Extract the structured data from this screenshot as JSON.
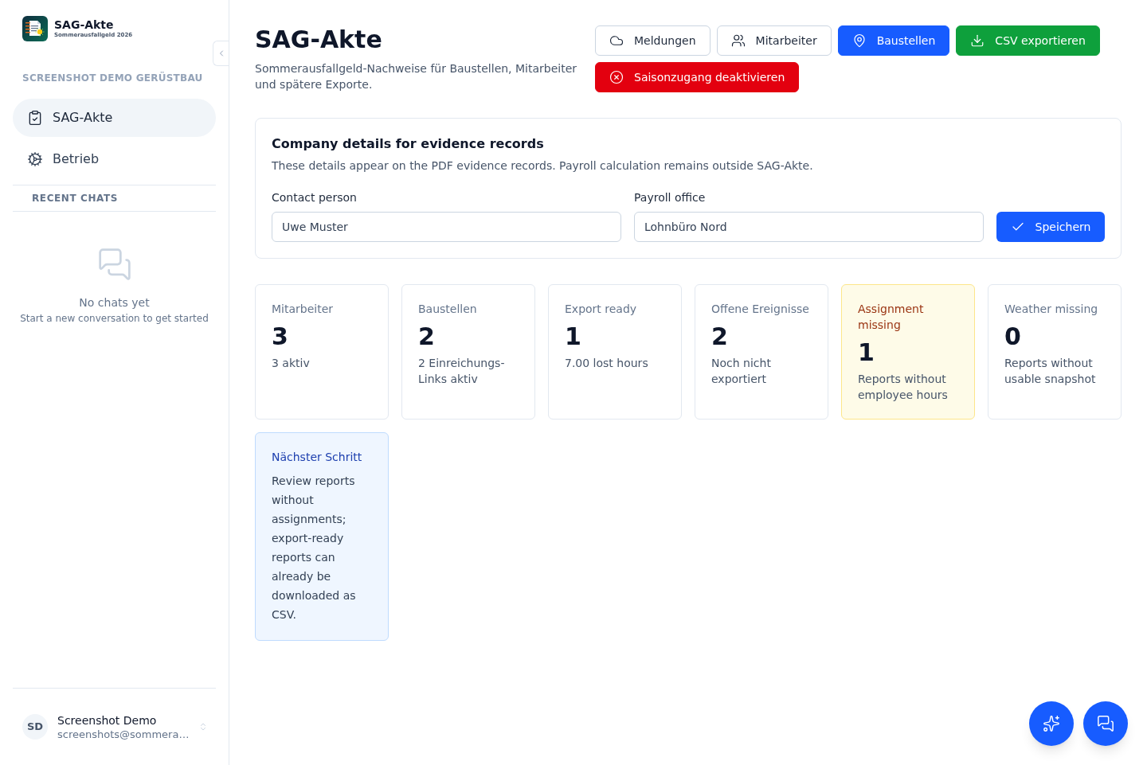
{
  "sidebar": {
    "brand": {
      "name": "SAG-Akte",
      "tagline": "Sommerausfallgeld 2026"
    },
    "workspace": "SCREENSHOT DEMO GERÜSTBAU",
    "nav_items": [
      {
        "label": "SAG-Akte",
        "selected": true
      },
      {
        "label": "Betrieb",
        "selected": false
      }
    ],
    "recent_chats": {
      "heading": "RECENT CHATS",
      "empty_title": "No chats yet",
      "empty_hint": "Start a new conversation to get started"
    },
    "user": {
      "initials": "SD",
      "name": "Screenshot Demo",
      "email": "screenshots@sommera…"
    }
  },
  "header": {
    "title": "SAG-Akte",
    "subtitle": "Sommerausfallgeld-Nachweise für Baustellen, Mitarbeiter und spätere Exporte.",
    "buttons": [
      {
        "label": "Meldungen",
        "kind": "outline"
      },
      {
        "label": "Mitarbeiter",
        "kind": "outline"
      },
      {
        "label": "Baustellen",
        "kind": "primary"
      },
      {
        "label": "CSV exportieren",
        "kind": "success"
      },
      {
        "label": "Saisonzugang deaktivieren",
        "kind": "danger"
      }
    ]
  },
  "company_details": {
    "title": "Company details for evidence records",
    "description": "These details appear on the PDF evidence records. Payroll calculation remains outside SAG-Akte.",
    "fields": [
      {
        "label": "Contact person",
        "value": "Uwe Muster"
      },
      {
        "label": "Payroll office",
        "value": "Lohnbüro Nord"
      }
    ],
    "save_button": "Speichern"
  },
  "stats": [
    {
      "label": "Mitarbeiter",
      "value": "3",
      "detail": "3 aktiv",
      "kind": "default"
    },
    {
      "label": "Baustellen",
      "value": "2",
      "detail": "2 Einreichungs-Links aktiv",
      "kind": "default"
    },
    {
      "label": "Export ready",
      "value": "1",
      "detail": "7.00 lost hours",
      "kind": "default"
    },
    {
      "label": "Offene Ereignisse",
      "value": "2",
      "detail": "Noch nicht exportiert",
      "kind": "default"
    },
    {
      "label": "Assignment missing",
      "value": "1",
      "detail": "Reports without employee hours",
      "kind": "warning"
    },
    {
      "label": "Weather missing",
      "value": "0",
      "detail": "Reports without usable snapshot",
      "kind": "default"
    }
  ],
  "next_step": {
    "title": "Nächster Schritt",
    "text": "Review reports without assignments; export-ready reports can already be downloaded as CSV."
  }
}
